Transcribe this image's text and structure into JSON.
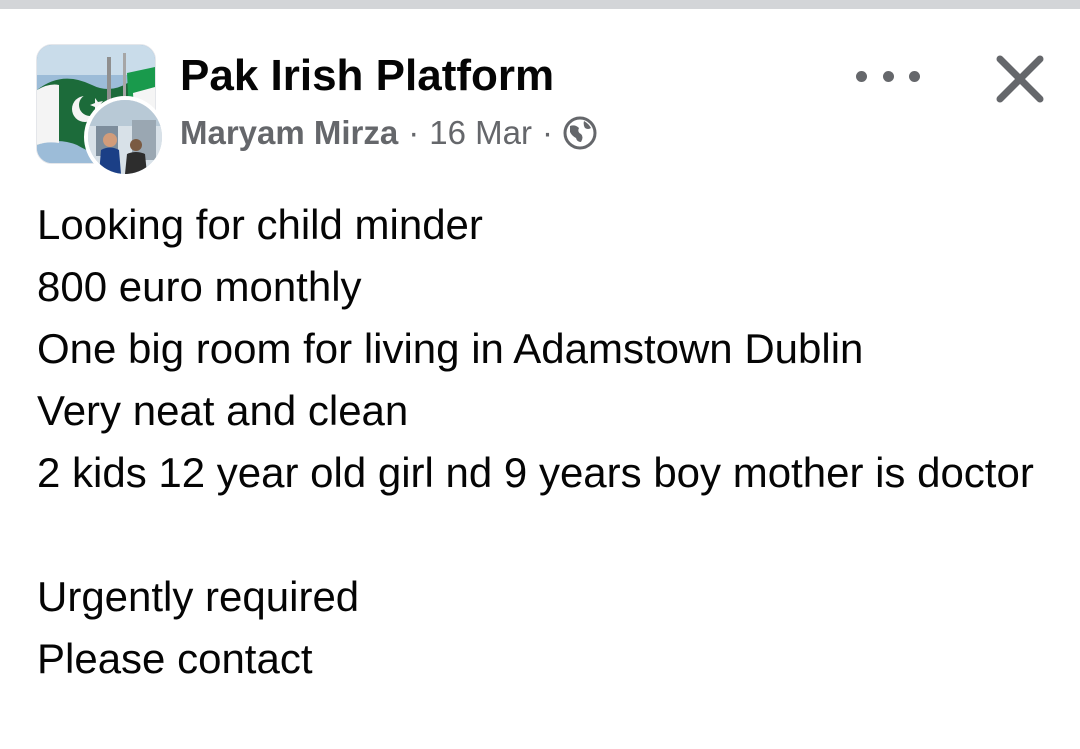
{
  "post": {
    "group_name": "Pak Irish Platform",
    "author": "Maryam Mirza",
    "separator": "·",
    "date": "16 Mar",
    "privacy_icon": "globe-icon",
    "more_icon": "more-horizontal-icon",
    "close_icon": "close-icon",
    "text_lines": [
      "Looking for child minder",
      "800 euro monthly",
      "One big room for living in Adamstown Dublin",
      "Very neat and clean",
      "2 kids 12 year old girl nd 9 years boy mother is doctor",
      "",
      "Urgently required",
      "Please contact"
    ]
  },
  "colors": {
    "primary_text": "#050505",
    "secondary_text": "#65676b",
    "top_bar": "#d3d5d8",
    "background": "#ffffff"
  }
}
